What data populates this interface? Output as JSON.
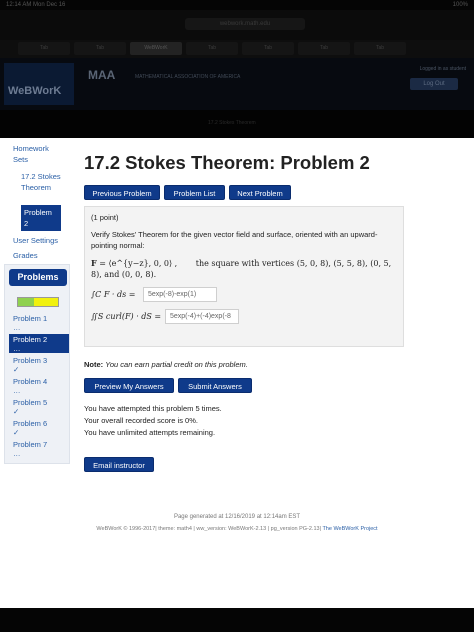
{
  "status_bar": {
    "time": "12:14 AM",
    "date": "Mon Dec 16",
    "battery": "100%"
  },
  "browser": {
    "url": "webwork.math.edu"
  },
  "tabs": [
    "Tab",
    "Tab",
    "WeBWorK",
    "Tab",
    "Tab",
    "Tab",
    "Tab"
  ],
  "header": {
    "webwork_logo": "WeBWorK",
    "maa": "MAA",
    "maa_sub": "MATHEMATICAL ASSOCIATION OF AMERICA",
    "logged_in": "Logged in as student",
    "logout": "Log Out"
  },
  "sidebar": {
    "homework_sets": "Homework Sets",
    "set_name": "17.2 Stokes Theorem",
    "problem_active": "Problem 2",
    "user_settings": "User Settings",
    "grades": "Grades"
  },
  "problems_panel": {
    "title": "Problems",
    "progress": {
      "correct_fraction": 0.4,
      "partial_fraction": 0.6,
      "correct_color": "#8fd14f",
      "partial_color": "#f1f10e"
    },
    "items": [
      {
        "label": "Problem 1",
        "status": "…"
      },
      {
        "label": "Problem 2",
        "status": "…"
      },
      {
        "label": "Problem 3",
        "status": "✓"
      },
      {
        "label": "Problem 4",
        "status": "…"
      },
      {
        "label": "Problem 5",
        "status": "✓"
      },
      {
        "label": "Problem 6",
        "status": "✓"
      },
      {
        "label": "Problem 7",
        "status": "…"
      }
    ]
  },
  "main": {
    "title": "17.2 Stokes Theorem: Problem 2",
    "buttons": {
      "previous": "Previous Problem",
      "list": "Problem List",
      "next": "Next Problem"
    },
    "points": "(1 point)",
    "statement": "Verify Stokes' Theorem for the given vector field and surface, oriented with an upward-pointing normal:",
    "field_lhs": "F",
    "field_rhs": "= ⟨e^{y−z}, 0, 0⟩ ,",
    "surface": "the square with vertices (5, 0, 8), (5, 5, 8), (0, 5, 8), and (0, 0, 8).",
    "answer1_label": "∫C F · ds =",
    "answer1_value": "5exp(-8)-exp(1)",
    "answer2_label": "∬S curl(F) · dS =",
    "answer2_value": "5exp(-4)+(-4)exp(-8"
  },
  "note": {
    "label": "Note:",
    "text": "You can earn partial credit on this problem."
  },
  "submit": {
    "preview": "Preview My Answers",
    "submit": "Submit Answers"
  },
  "attempts": {
    "line1": "You have attempted this problem 5 times.",
    "line2": "Your overall recorded score is 0%.",
    "line3": "You have unlimited attempts remaining."
  },
  "email": "Email instructor",
  "footer": {
    "generated": "Page generated at 12/16/2019 at 12:14am EST",
    "copyright": "WeBWorK © 1996-2017| theme: math4 | ww_version: WeBWorK-2.13 | pg_version PG-2.13|",
    "project_link": "The WeBWorK Project"
  }
}
